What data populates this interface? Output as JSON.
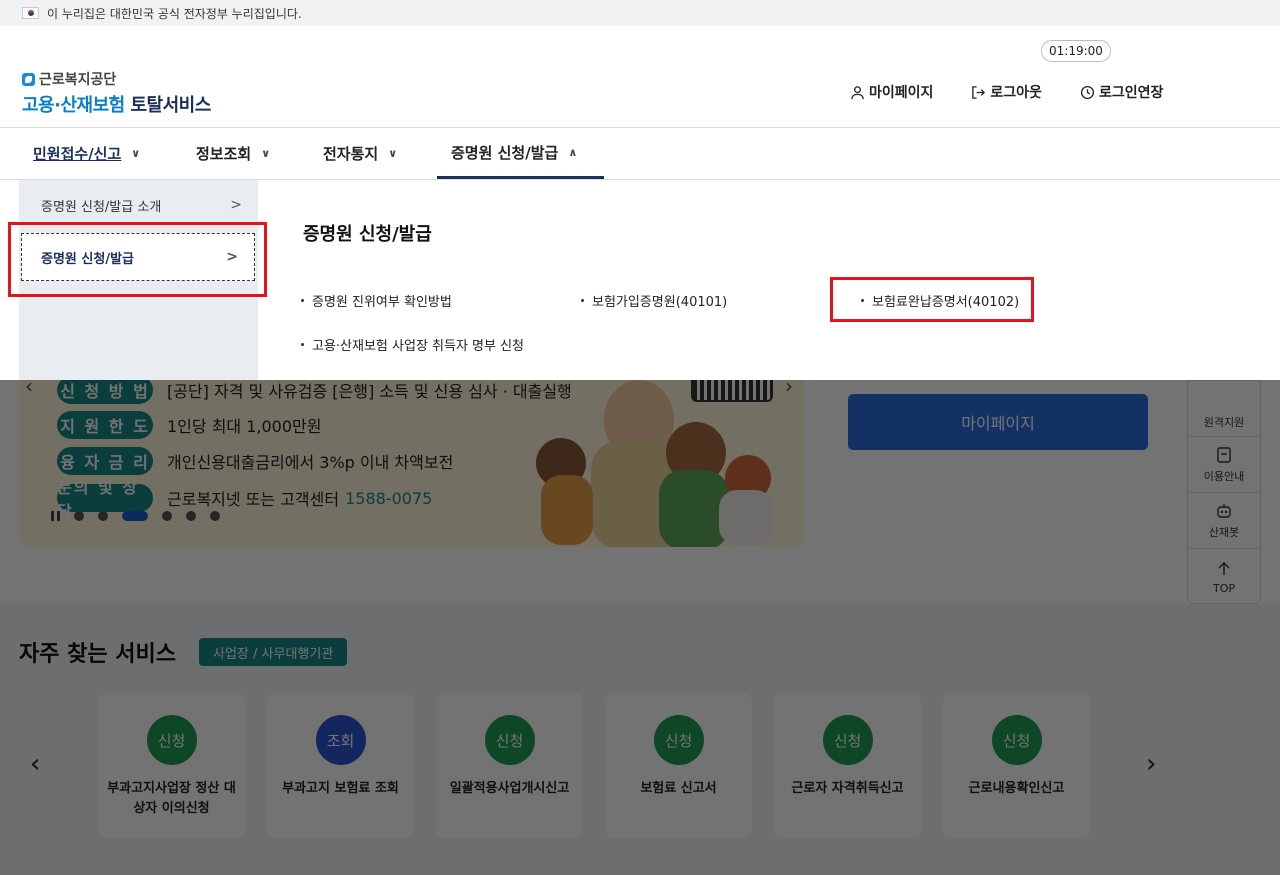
{
  "govbar": {
    "text": "이 누리집은 대한민국 공식 전자정부 누리집입니다."
  },
  "header": {
    "logo_sub": "근로복지공단",
    "logo_blue": "고용·산재보험",
    "logo_dark": "토탈서비스",
    "timer": "01:19:00",
    "links": {
      "mypage": "마이페이지",
      "logout": "로그아웃",
      "extend": "로그인연장"
    }
  },
  "gnb": {
    "items": [
      {
        "label": "민원접수/신고"
      },
      {
        "label": "정보조회"
      },
      {
        "label": "전자통지"
      },
      {
        "label": "증명원 신청/발급"
      }
    ]
  },
  "mega": {
    "side": [
      {
        "label": "증명원 신청/발급 소개"
      },
      {
        "label": "증명원 신청/발급"
      }
    ],
    "title": "증명원 신청/발급",
    "links": [
      "증명원 진위여부 확인방법",
      "보험가입증명원(40101)",
      "보험료완납증명서(40102)",
      "고용·산재보험 사업장 취득자 명부 신청"
    ]
  },
  "banner": {
    "rows": [
      {
        "pill": "신 청 방 법",
        "text": "[공단] 자격 및 사유검증 [은행] 소득 및 신용 심사 · 대출실행"
      },
      {
        "pill": "지 원 한 도",
        "text": "1인당 최대 1,000만원"
      },
      {
        "pill": "융 자 금 리",
        "text": "개인신용대출금리에서 3%p 이내 차액보전"
      },
      {
        "pill": "문의 및 상담",
        "text": "근로복지넷 또는 고객센터",
        "phone": "1588-0075"
      }
    ]
  },
  "side_card": {
    "mypage_button": "마이페이지"
  },
  "quick": {
    "partial": "원격지원",
    "guide": "이용안내",
    "bot": "산재봇",
    "top": "TOP"
  },
  "freq": {
    "title": "자주 찾는 서비스",
    "tag": "사업장 / 사무대행기관",
    "cards": [
      {
        "badge": "신청",
        "label": "부과고지사업장 정산 대상자 이의신청"
      },
      {
        "badge": "조회",
        "label": "부과고지 보험료 조회"
      },
      {
        "badge": "신청",
        "label": "일괄적용사업개시신고"
      },
      {
        "badge": "신청",
        "label": "보험료 신고서"
      },
      {
        "badge": "신청",
        "label": "근로자 자격취득신고"
      },
      {
        "badge": "신청",
        "label": "근로내용확인신고"
      }
    ]
  },
  "colors": {
    "teal": "#148b87",
    "navy": "#1b2f5b",
    "blue": "#2a6de0",
    "highlight": "#e4141d",
    "green": "#1e9e52"
  }
}
